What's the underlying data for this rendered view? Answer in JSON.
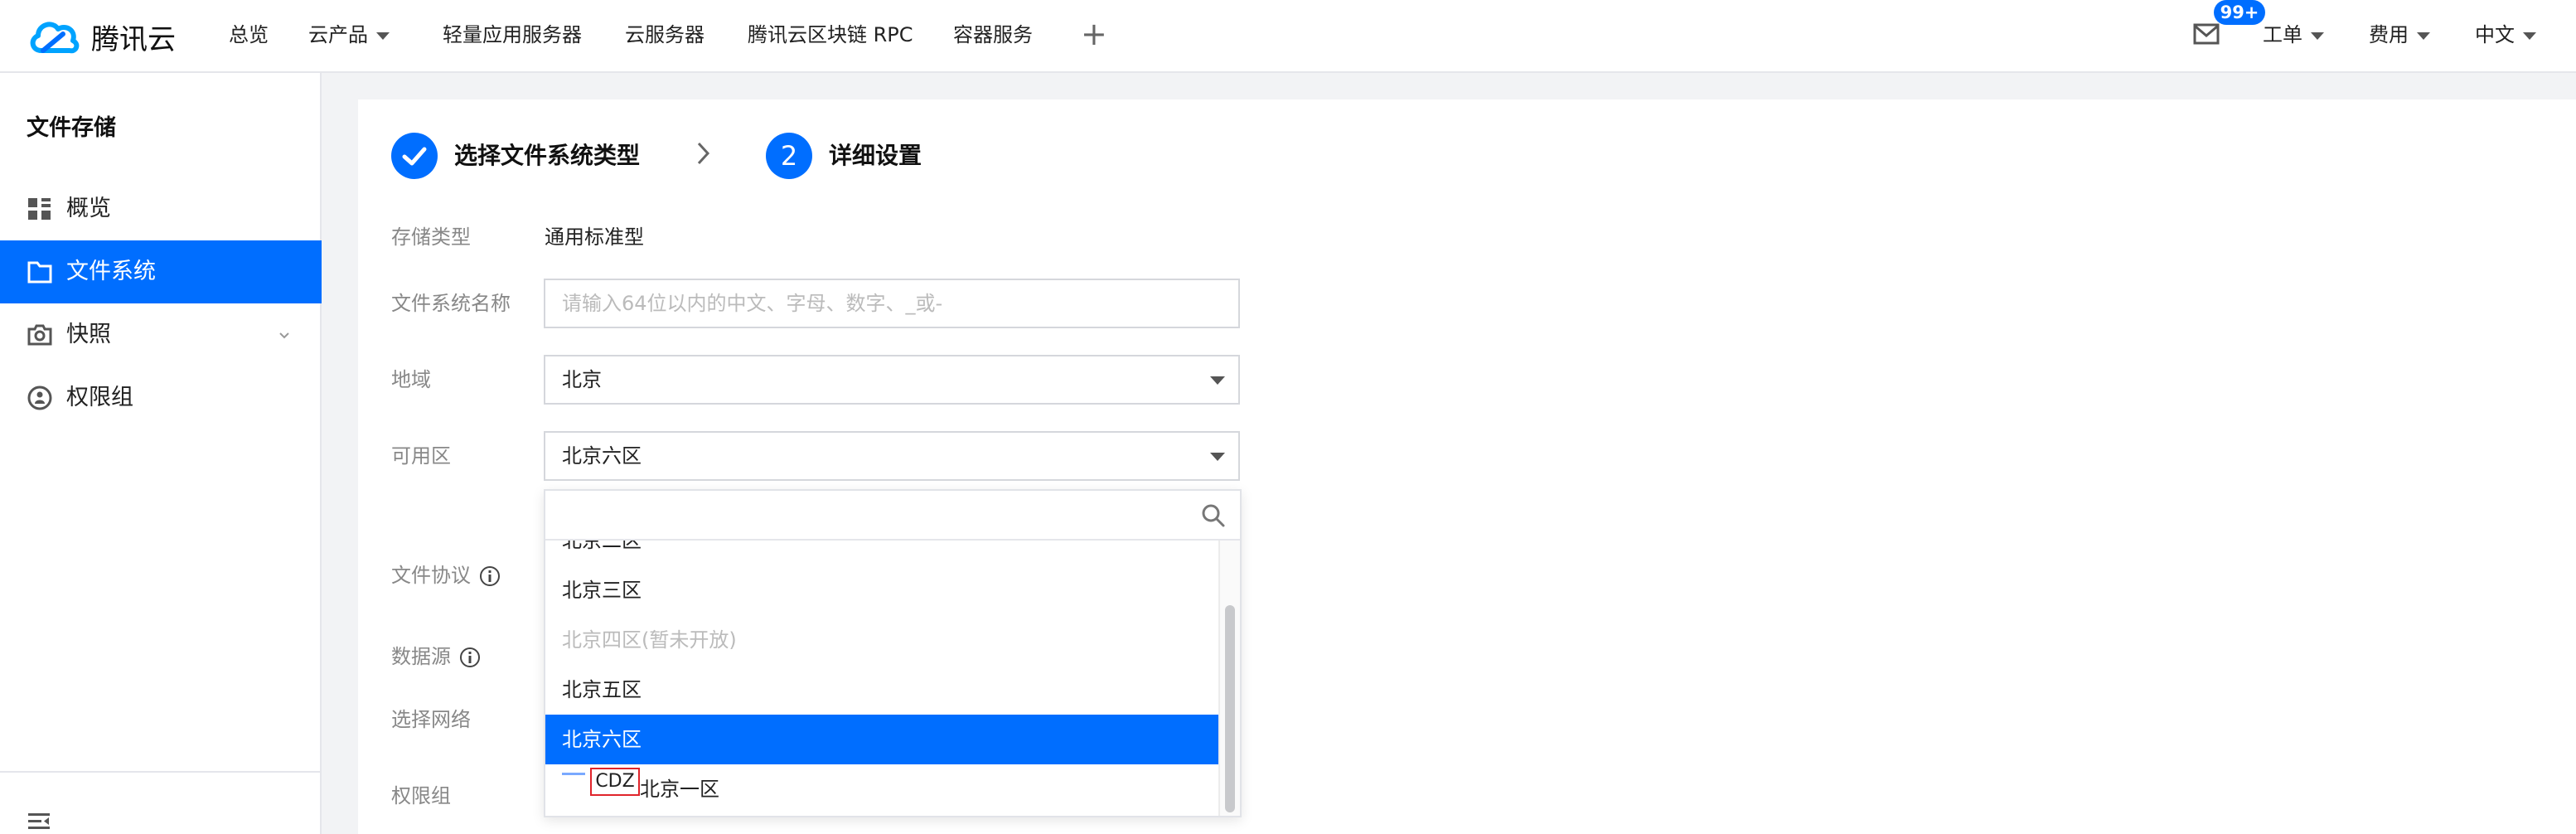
{
  "brand": {
    "name": "腾讯云",
    "accent": "#006eff"
  },
  "topnav": {
    "items": [
      {
        "label": "总览"
      },
      {
        "label": "云产品"
      },
      {
        "label": "轻量应用服务器"
      },
      {
        "label": "云服务器"
      },
      {
        "label": "腾讯云区块链 RPC"
      },
      {
        "label": "容器服务"
      }
    ],
    "add_label": "+",
    "message_badge": "99+",
    "right": [
      {
        "label": "工单"
      },
      {
        "label": "费用"
      },
      {
        "label": "中文"
      }
    ]
  },
  "sidebar": {
    "title": "文件存储",
    "items": [
      {
        "label": "概览",
        "icon": "grid-icon"
      },
      {
        "label": "文件系统",
        "icon": "folder-icon",
        "active": true
      },
      {
        "label": "快照",
        "icon": "camera-icon"
      },
      {
        "label": "权限组",
        "icon": "permission-icon"
      }
    ]
  },
  "steps": [
    {
      "label": "选择文件系统类型",
      "state": "done"
    },
    {
      "number": "2",
      "label": "详细设置",
      "state": "current"
    }
  ],
  "form": {
    "storage_type": {
      "label": "存储类型",
      "value": "通用标准型"
    },
    "fs_name": {
      "label": "文件系统名称",
      "placeholder": "请输入64位以内的中文、字母、数字、_或-"
    },
    "region": {
      "label": "地域",
      "value": "北京"
    },
    "zone": {
      "label": "可用区",
      "value": "北京六区"
    },
    "protocol": {
      "label": "文件协议"
    },
    "data_source": {
      "label": "数据源"
    },
    "network": {
      "label": "选择网络"
    },
    "permission_group": {
      "label": "权限组"
    }
  },
  "dropdown": {
    "search_value": "",
    "options": [
      {
        "label": "北京二区",
        "state": "normal"
      },
      {
        "label": "北京三区",
        "state": "normal"
      },
      {
        "label": "北京四区(暂未开放)",
        "state": "disabled"
      },
      {
        "label": "北京五区",
        "state": "normal"
      },
      {
        "label": "北京六区",
        "state": "selected"
      }
    ],
    "cdz_tag": "CDZ",
    "cdz_label": "北京一区"
  }
}
